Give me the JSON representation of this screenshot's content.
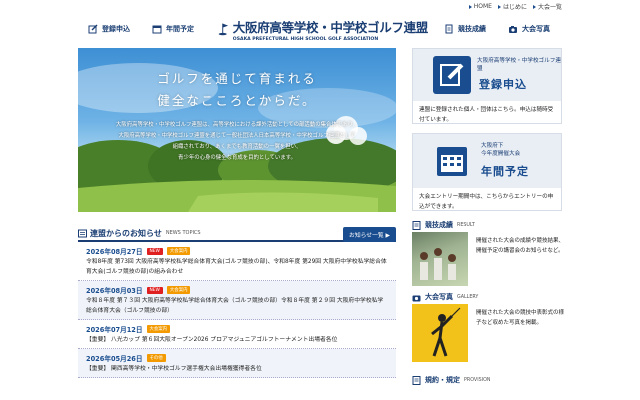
{
  "toplinks": [
    {
      "label": "HOME"
    },
    {
      "label": "はじめに"
    },
    {
      "label": "大会一覧"
    }
  ],
  "nav": {
    "register": "登録申込",
    "schedule": "年間予定",
    "results": "競技成績",
    "photos": "大会写真"
  },
  "logo": {
    "title": "大阪府高等学校・中学校ゴルフ連盟",
    "sub": "OSAKA PREFECTURAL HIGH SCHOOL GOLF ASSOCIATION"
  },
  "hero": {
    "line1": "ゴルフを通じて育まれる",
    "line2": "健全なこころとからだ。",
    "body": [
      "大阪府高等学校・中学校ゴルフ連盟は、高等学校における課外活動としての部活動の集合体であり、",
      "大阪府高等学校・中学校ゴルフ連盟を通じて一般社団法人日本高等学校・中学校ゴルフ連盟として",
      "組織されており、あくまでも教育活動の一翼を担い、",
      "青少年の心身の健全な育成を目的としています。"
    ]
  },
  "news": {
    "title": "連盟からのお知らせ",
    "en": "NEWS TOPICS",
    "list_button": "お知らせ一覧 ▶",
    "items": [
      {
        "date": "2026年08月27日",
        "badges": [
          "NEW",
          "大会案内"
        ],
        "text": "令和8年度 第73回 大阪府高等学校私学総合体育大会(ゴルフ競技の部)、令和8年度 第29回 大阪府中学校私学総合体育大会(ゴルフ競技の部)の組み合わせ"
      },
      {
        "date": "2026年08月03日",
        "badges": [
          "NEW",
          "大会案内"
        ],
        "text": "令和８年度 第７３回 大阪府高等学校私学総合体育大会（ゴルフ競技の部）令和８年度 第２９回 大阪府中学校私学総合体育大会（ゴルフ競技の部）"
      },
      {
        "date": "2026年07月12日",
        "badges": [
          "大会案内"
        ],
        "text": "【重要】 八光カップ 第６回大阪オープン2026 プロアマジュニアゴルフトーナメント出場者各位"
      },
      {
        "date": "2026年05月26日",
        "badges": [
          "その他"
        ],
        "text": "【重要】 関西高等学校・中学校ゴルフ選手権大会出場権獲得者各位"
      }
    ]
  },
  "sidebar": {
    "reg": {
      "small": "大阪府高等学校・中学校ゴルフ連盟",
      "big": "登録申込",
      "text": "連盟に登録された個人・団体はこちら。申込は随時受付ています。"
    },
    "sched": {
      "small1": "大阪府下",
      "small2": "今年度開催大会",
      "big": "年間予定",
      "text": "大会エントリー期間中は、こちらからエントリーの申込ができます。"
    },
    "results": {
      "title": "競技成績",
      "en": "RESULT",
      "text": "開催された大会の成績や競技結果、開催予定の講習会のお知らせなど。"
    },
    "photos": {
      "title": "大会写真",
      "en": "GALLERY",
      "text": "開催された大会の競技中表彰式の様子など収めた写真を掲載。"
    },
    "rules": {
      "title": "規約・規定",
      "en": "PROVISION"
    }
  },
  "colors": {
    "navy": "#1a3e73",
    "blue": "#1a4d8f",
    "red": "#e02020",
    "orange": "#f29a00"
  }
}
